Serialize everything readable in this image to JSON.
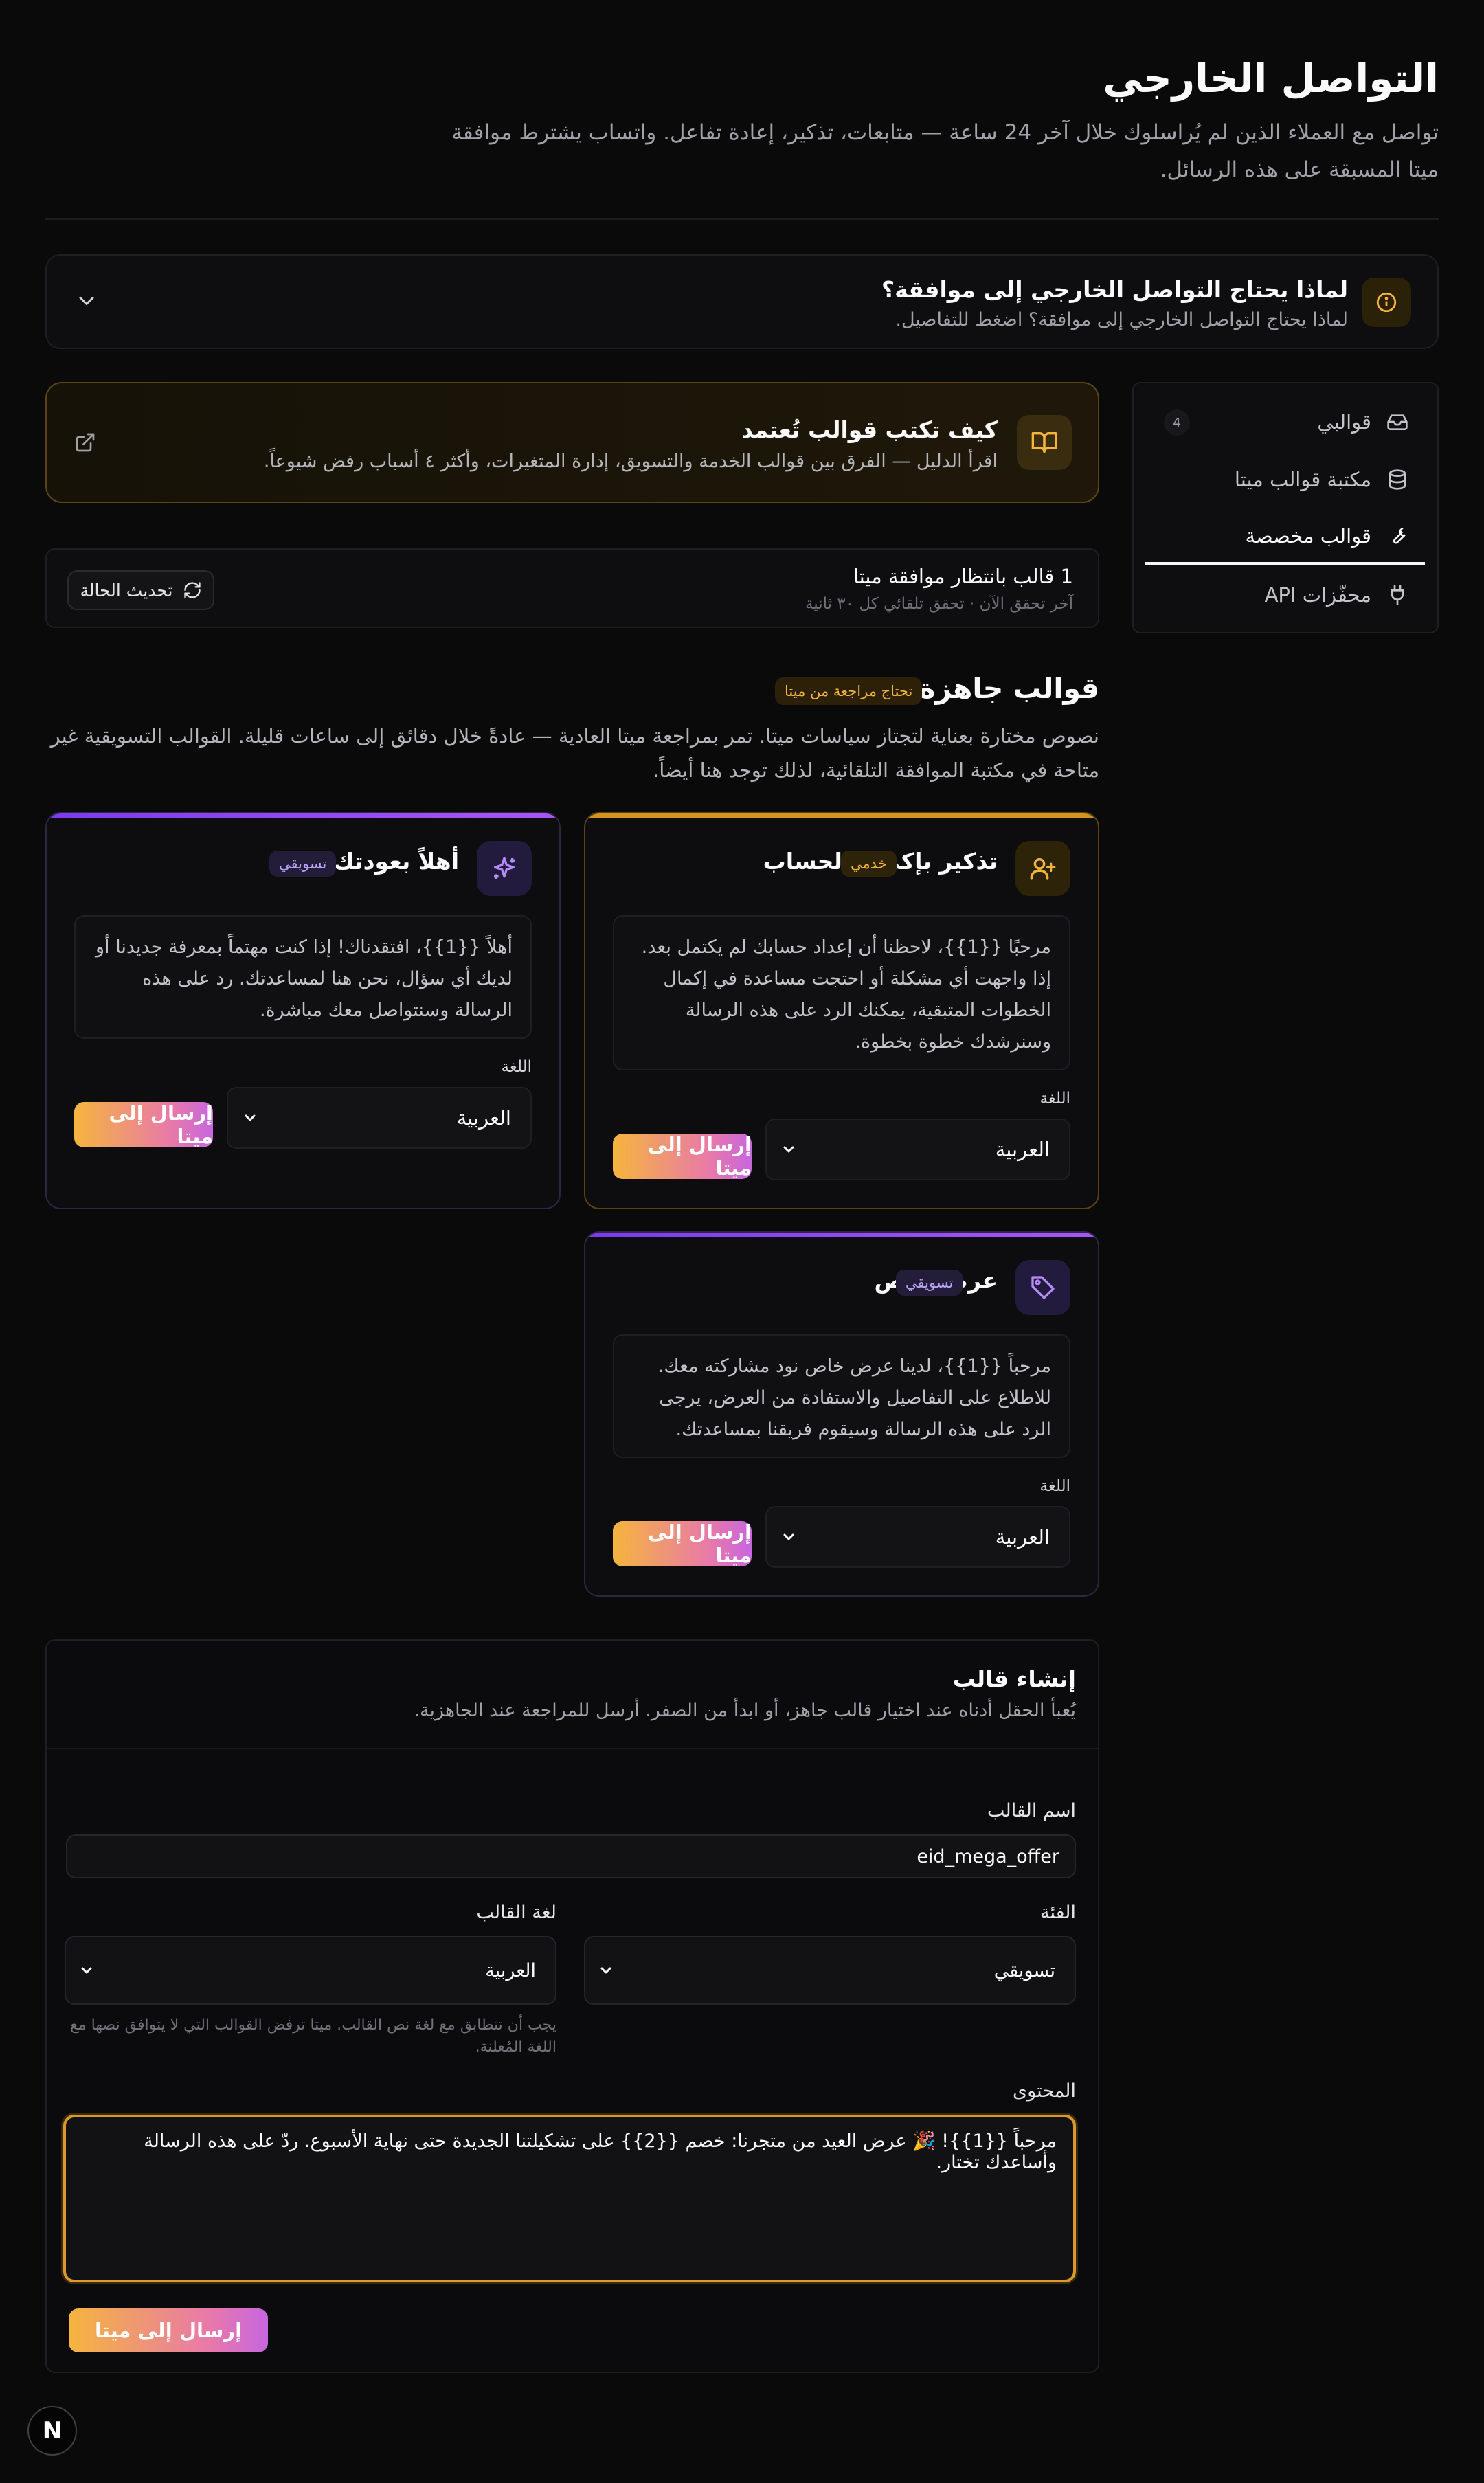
{
  "header": {
    "title": "التواصل الخارجي",
    "subtitle": "تواصل مع العملاء الذين لم يُراسلوك خلال آخر 24 ساعة — متابعات، تذكير، إعادة تفاعل. واتساب يشترط موافقة ميتا المسبقة على هذه الرسائل."
  },
  "notice": {
    "title": "لماذا يحتاج التواصل الخارجي إلى موافقة؟",
    "subtitle": "لماذا يحتاج التواصل الخارجي إلى موافقة؟ اضغط للتفاصيل.",
    "icon": "info-icon"
  },
  "sidebar": {
    "items": [
      {
        "label": "قوالبي",
        "icon": "inbox-icon",
        "count": "4"
      },
      {
        "label": "مكتبة قوالب ميتا",
        "icon": "database-icon"
      },
      {
        "label": "قوالب مخصصة",
        "icon": "wrench-icon",
        "active": true
      },
      {
        "label": "محفّزات API",
        "icon": "plug-icon"
      }
    ]
  },
  "guide": {
    "title": "كيف تكتب قوالب تُعتمد",
    "subtitle": "اقرأ الدليل — الفرق بين قوالب الخدمة والتسويق، إدارة المتغيرات، وأكثر ٤ أسباب رفض شيوعاً."
  },
  "status": {
    "title": "1 قالب بانتظار موافقة ميتا",
    "subtitle": "آخر تحقق الآن · تحقق تلقائي كل ٣٠ ثانية",
    "refresh_label": "تحديث الحالة"
  },
  "ready": {
    "title": "قوالب جاهزة",
    "badge": "تحتاج مراجعة من ميتا",
    "description": "نصوص مختارة بعناية لتجتاز سياسات ميتا. تمر بمراجعة ميتا العادية — عادةً خلال دقائق إلى ساعات قليلة. القوالب التسويقية غير متاحة في مكتبة الموافقة التلقائية، لذلك توجد هنا أيضاً."
  },
  "cards": [
    {
      "name": "تذكير بإكمال الحساب",
      "badge": "خدمي",
      "body": "مرحبًا {{1}}، لاحظنا أن إعداد حسابك لم يكتمل بعد. إذا واجهت أي مشكلة أو احتجت مساعدة في إكمال الخطوات المتبقية، يمكنك الرد على هذه الرسالة وسنرشدك خطوة بخطوة.",
      "lang_label": "اللغة",
      "lang_value": "العربية",
      "send_label": "إرسال إلى ميتا"
    },
    {
      "name": "أهلاً بعودتك",
      "badge": "تسويقي",
      "body": "أهلاً {{1}}، افتقدناك! إذا كنت مهتماً بمعرفة جديدنا أو لديك أي سؤال، نحن هنا لمساعدتك. رد على هذه الرسالة وسنتواصل معك مباشرة.",
      "lang_label": "اللغة",
      "lang_value": "العربية",
      "send_label": "إرسال إلى ميتا"
    },
    {
      "name": "عرض خاص",
      "badge": "تسويقي",
      "body": "مرحباً {{1}}، لدينا عرض خاص نود مشاركته معك. للاطلاع على التفاصيل والاستفادة من العرض، يرجى الرد على هذه الرسالة وسيقوم فريقنا بمساعدتك.",
      "lang_label": "اللغة",
      "lang_value": "العربية",
      "send_label": "إرسال إلى ميتا"
    }
  ],
  "create": {
    "title": "إنشاء قالب",
    "subtitle": "يُعبأ الحقل أدناه عند اختيار قالب جاهز، أو ابدأ من الصفر. أرسل للمراجعة عند الجاهزية.",
    "name_label": "اسم القالب",
    "name_value": "eid_mega_offer",
    "category_label": "الفئة",
    "category_value": "تسويقي",
    "lang_label": "لغة القالب",
    "lang_value": "العربية",
    "lang_hint": "يجب أن تتطابق مع لغة نص القالب. ميتا ترفض القوالب التي لا يتوافق نصها مع اللغة المُعلنة.",
    "content_label": "المحتوى",
    "content_value": "مرحباً {{1}}! 🎉 عرض العيد من متجرنا: خصم {{2}} على تشكيلتنا الجديدة حتى نهاية الأسبوع. ردّ على هذه الرسالة وأساعدك تختار.",
    "send_label": "إرسال إلى ميتا"
  },
  "dev_badge": "N",
  "colors": {
    "background": "#0a0a0b",
    "accent_amber": "#f5b53d",
    "accent_purple": "#a855f7",
    "send_gradient_start": "#f5b53d",
    "send_gradient_end": "#c766e0"
  }
}
